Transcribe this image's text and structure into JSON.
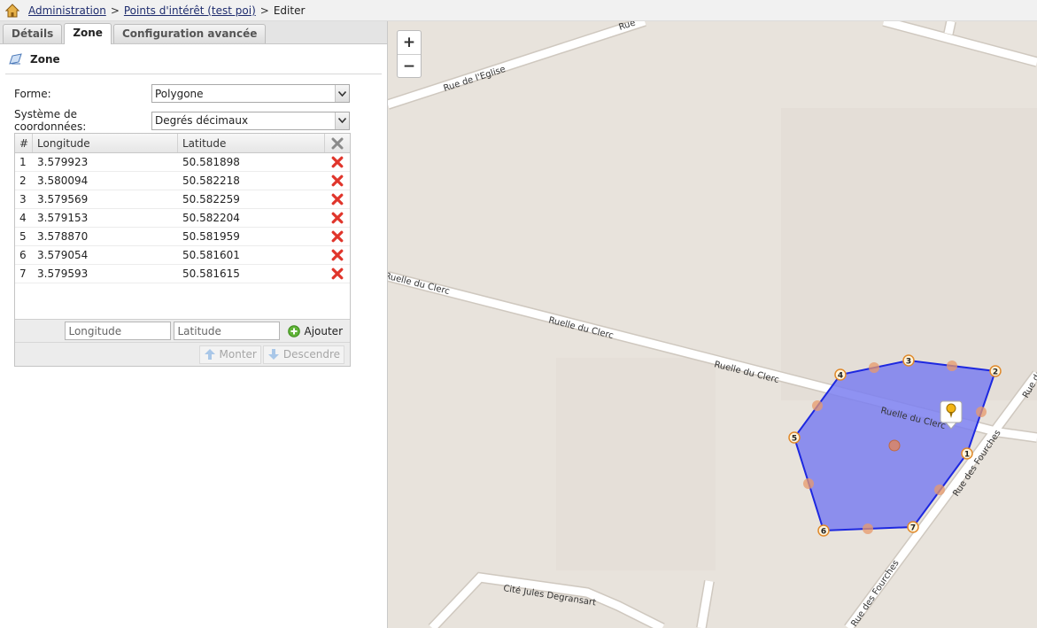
{
  "breadcrumb": {
    "items": [
      "Administration",
      "Points d'intérêt (test poi)",
      "Editer"
    ],
    "separator": ">"
  },
  "tabs": [
    "Détails",
    "Zone",
    "Configuration avancée"
  ],
  "active_tab": "Zone",
  "section": {
    "title": "Zone",
    "icon": "polygon-icon"
  },
  "form": {
    "shape_label": "Forme:",
    "shape_value": "Polygone",
    "coords_label": "Système de coordonnées:",
    "coords_value": "Degrés décimaux"
  },
  "grid": {
    "headers": {
      "num": "#",
      "lon": "Longitude",
      "lat": "Latitude"
    },
    "rows": [
      {
        "num": "1",
        "lon": "3.579923",
        "lat": "50.581898"
      },
      {
        "num": "2",
        "lon": "3.580094",
        "lat": "50.582218"
      },
      {
        "num": "3",
        "lon": "3.579569",
        "lat": "50.582259"
      },
      {
        "num": "4",
        "lon": "3.579153",
        "lat": "50.582204"
      },
      {
        "num": "5",
        "lon": "3.578870",
        "lat": "50.581959"
      },
      {
        "num": "6",
        "lon": "3.579054",
        "lat": "50.581601"
      },
      {
        "num": "7",
        "lon": "3.579593",
        "lat": "50.581615"
      }
    ],
    "longitude_placeholder": "Longitude",
    "latitude_placeholder": "Latitude",
    "add_label": "Ajouter",
    "up_label": "Monter",
    "down_label": "Descendre"
  },
  "map": {
    "zoom_in": "+",
    "zoom_out": "−",
    "streets": {
      "eglise": "Rue de l'Eglise",
      "rue_top": "Rue",
      "clerc_edge": "Ruelle du Clerc",
      "clerc_1": "Ruelle du Clerc",
      "clerc_2": "Ruelle du Clerc",
      "clerc_3": "Ruelle du Clerc",
      "fourches_1": "Rue des Fourches",
      "fourches_2": "Rue des Fourches",
      "rue_de": "Rue de",
      "degransart": "Cité Jules Degransart"
    },
    "vertex_labels": [
      "1",
      "2",
      "3",
      "4",
      "5",
      "6",
      "7"
    ],
    "polygon_color": "#7b7ff0",
    "polygon_stroke": "#1d28e0"
  }
}
